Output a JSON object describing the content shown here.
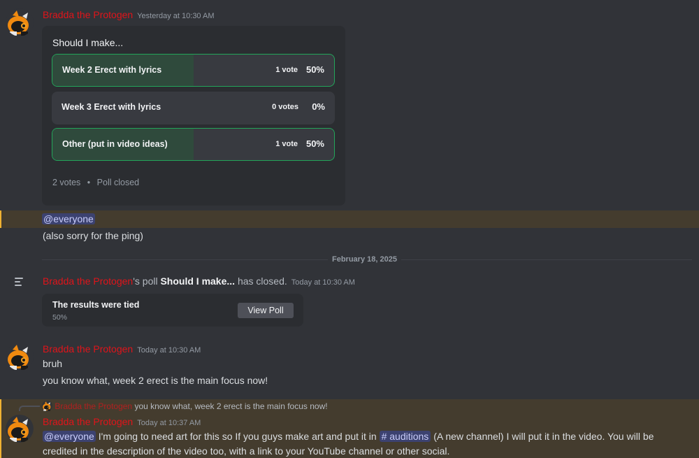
{
  "author": {
    "name": "Bradda the Protogen",
    "color": "#e0141a"
  },
  "message1": {
    "timestamp": "Yesterday at 10:30 AM",
    "poll": {
      "question": "Should I make...",
      "options": [
        {
          "label": "Week 2 Erect with lyrics",
          "votes": "1 vote",
          "percent": "50%",
          "fill": 0.5,
          "voted": true
        },
        {
          "label": "Week 3 Erect with lyrics",
          "votes": "0 votes",
          "percent": "0%",
          "fill": 0,
          "voted": false
        },
        {
          "label": "Other (put in video ideas)",
          "votes": "1 vote",
          "percent": "50%",
          "fill": 0.5,
          "voted": true
        }
      ],
      "total_votes": "2 votes",
      "separator": "•",
      "status": "Poll closed"
    }
  },
  "message2": {
    "mention": "@everyone",
    "text": "(also sorry for the ping)"
  },
  "date_divider": "February 18, 2025",
  "system_message": {
    "poll_suffix": "'s poll",
    "poll_title": "Should I make...",
    "closed_text": "has closed.",
    "timestamp": "Today at 10:30 AM",
    "result_title": "The results were tied",
    "result_pct": "50%",
    "button": "View Poll"
  },
  "message3": {
    "timestamp": "Today at 10:30 AM",
    "line1": "bruh",
    "line2": "you know what, week 2 erect  is the main focus now!"
  },
  "message4": {
    "reply_text": "you know what, week 2 erect  is the main focus now!",
    "timestamp": "Today at 10:37 AM",
    "mention": "@everyone",
    "text_before_channel": " I'm going to need art for this so If you guys make art and put it in ",
    "channel": "# auditions",
    "text_after_channel": " (A new channel) I will put it in the video. You will be credited in the description of the video too, with a link to your YouTube channel or other social."
  },
  "colors": {
    "background": "#313338",
    "highlight": "#443c2e",
    "voted_border": "#23a55a",
    "mention_bg": "#3c4270"
  }
}
